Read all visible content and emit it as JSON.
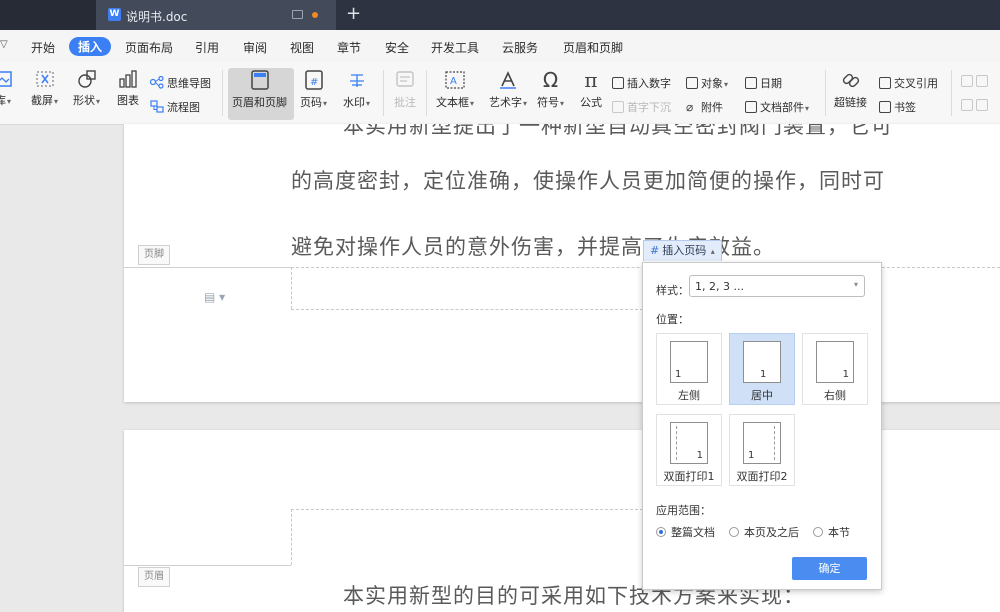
{
  "window": {
    "tab_title": "说明书.doc",
    "doc_icon": "W",
    "new_tab": "+"
  },
  "menu": {
    "items": [
      "开始",
      "插入",
      "页面布局",
      "引用",
      "审阅",
      "视图",
      "章节",
      "安全",
      "开发工具",
      "云服务",
      "页眉和页脚"
    ],
    "active": "插入"
  },
  "toolbar": {
    "gallery": "库",
    "screenshot": "截屏",
    "shapes": "形状",
    "chart": "图表",
    "mindmap": "思维导图",
    "flowchart": "流程图",
    "header_footer": "页眉和页脚",
    "page_number": "页码",
    "watermark": "水印",
    "comment": "批注",
    "textbox": "文本框",
    "wordart": "艺术字",
    "symbol": "符号",
    "formula": "公式",
    "insert_number": "插入数字",
    "object": "对象",
    "date": "日期",
    "dropcap": "首字下沉",
    "attachment": "附件",
    "doc_parts": "文档部件",
    "hyperlink": "超链接",
    "cross_ref": "交叉引用",
    "bookmark": "书签"
  },
  "document": {
    "line1": "本实用新型提出了一种新型自动真空密封阀门装置，它可",
    "line2": "的高度密封，定位准确，使操作人员更加简便的操作，同时可",
    "line3": "避免对操作人员的意外伤害，并提高了生产效益。",
    "footer_tag": "页脚",
    "header_tag": "页眉",
    "page2_line": "本实用新型的目的可采用如下技术方案来实现："
  },
  "page_number_popup": {
    "trigger_label": "插入页码",
    "style_label": "样式：",
    "style_value": "1, 2, 3 ...",
    "position_label": "位置：",
    "positions": [
      {
        "label": "左侧",
        "num": "1"
      },
      {
        "label": "居中",
        "num": "1"
      },
      {
        "label": "右侧",
        "num": "1"
      },
      {
        "label": "双面打印1",
        "num": "1"
      },
      {
        "label": "双面打印2",
        "num": "1"
      }
    ],
    "selected_position": "居中",
    "range_label": "应用范围：",
    "range_options": [
      "整篇文档",
      "本页及之后",
      "本节"
    ],
    "selected_range": "整篇文档",
    "confirm": "确定"
  }
}
